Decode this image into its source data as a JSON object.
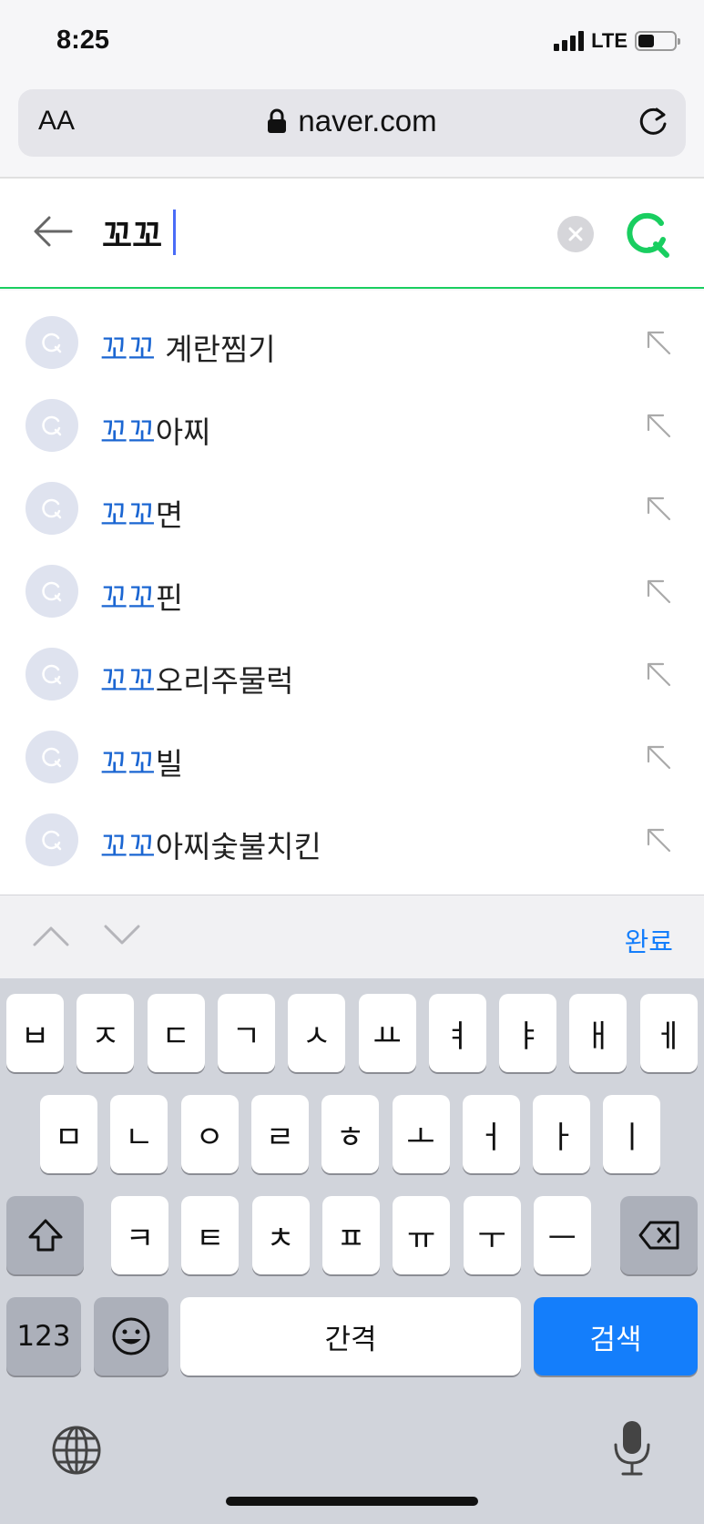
{
  "status_bar": {
    "time": "8:25",
    "network": "LTE"
  },
  "url_bar": {
    "text_size_label": "AA",
    "domain": "naver.com"
  },
  "search": {
    "query": "꼬꼬",
    "accent_color": "#19ce60"
  },
  "suggestions": [
    {
      "highlight": "꼬꼬",
      "rest": " 계란찜기"
    },
    {
      "highlight": "꼬꼬",
      "rest": "아찌"
    },
    {
      "highlight": "꼬꼬",
      "rest": "면"
    },
    {
      "highlight": "꼬꼬",
      "rest": "핀"
    },
    {
      "highlight": "꼬꼬",
      "rest": "오리주물럭"
    },
    {
      "highlight": "꼬꼬",
      "rest": "빌"
    },
    {
      "highlight": "꼬꼬",
      "rest": "아찌숯불치킨"
    }
  ],
  "kb_toolbar": {
    "done_label": "완료"
  },
  "keyboard": {
    "row1": [
      "ㅂ",
      "ㅈ",
      "ㄷ",
      "ㄱ",
      "ㅅ",
      "ㅛ",
      "ㅕ",
      "ㅑ",
      "ㅐ",
      "ㅔ"
    ],
    "row2": [
      "ㅁ",
      "ㄴ",
      "ㅇ",
      "ㄹ",
      "ㅎ",
      "ㅗ",
      "ㅓ",
      "ㅏ",
      "ㅣ"
    ],
    "row3": [
      "ㅋ",
      "ㅌ",
      "ㅊ",
      "ㅍ",
      "ㅠ",
      "ㅜ",
      "ㅡ"
    ],
    "numbers_label": "123",
    "space_label": "간격",
    "search_label": "검색"
  }
}
